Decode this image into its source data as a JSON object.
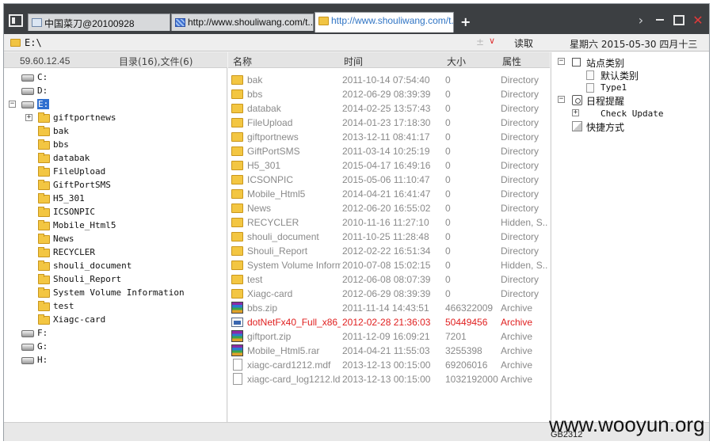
{
  "tabs": [
    {
      "label": "中国菜刀@20100928",
      "icon": "page-icon",
      "active": false
    },
    {
      "label": "http://www.shouliwang.com/t...",
      "icon": "image-icon",
      "active": false
    },
    {
      "label": "http://www.shouliwang.com/t...",
      "icon": "folder-icon",
      "active": true
    }
  ],
  "tabbar": {
    "add_label": "+",
    "menu_chevron": "›",
    "close_label": "✕"
  },
  "address": {
    "path": "E:\\",
    "plusminus": "±",
    "dropdown": "∨",
    "read_label": "读取",
    "datetime": "星期六 2015-05-30 四月十三"
  },
  "tree_header": {
    "ip": "59.60.12.45",
    "count": "目录(16),文件(6)"
  },
  "tree": {
    "drives": [
      {
        "label": "C:"
      },
      {
        "label": "D:"
      },
      {
        "label": "E:",
        "expander": "−"
      },
      {
        "label": "F:"
      },
      {
        "label": "G:"
      },
      {
        "label": "H:"
      }
    ],
    "folders": [
      {
        "label": "giftportnews",
        "expander": "+"
      },
      {
        "label": "bak"
      },
      {
        "label": "bbs"
      },
      {
        "label": "databak"
      },
      {
        "label": "FileUpload"
      },
      {
        "label": "GiftPortSMS"
      },
      {
        "label": "H5_301"
      },
      {
        "label": "ICSONPIC"
      },
      {
        "label": "Mobile_Html5"
      },
      {
        "label": "News"
      },
      {
        "label": "RECYCLER"
      },
      {
        "label": "shouli_document"
      },
      {
        "label": "Shouli_Report"
      },
      {
        "label": "System Volume Information"
      },
      {
        "label": "test"
      },
      {
        "label": "Xiagc-card"
      }
    ]
  },
  "list_header": {
    "name": "名称",
    "time": "时间",
    "size": "大小",
    "attr": "属性"
  },
  "files": [
    {
      "name": "bak",
      "time": "2011-10-14 07:54:40",
      "size": "0",
      "attr": "Directory",
      "icon": "folder"
    },
    {
      "name": "bbs",
      "time": "2012-06-29 08:39:39",
      "size": "0",
      "attr": "Directory",
      "icon": "folder"
    },
    {
      "name": "databak",
      "time": "2014-02-25 13:57:43",
      "size": "0",
      "attr": "Directory",
      "icon": "folder"
    },
    {
      "name": "FileUpload",
      "time": "2014-01-23 17:18:30",
      "size": "0",
      "attr": "Directory",
      "icon": "folder"
    },
    {
      "name": "giftportnews",
      "time": "2013-12-11 08:41:17",
      "size": "0",
      "attr": "Directory",
      "icon": "folder"
    },
    {
      "name": "GiftPortSMS",
      "time": "2011-03-14 10:25:19",
      "size": "0",
      "attr": "Directory",
      "icon": "folder"
    },
    {
      "name": "H5_301",
      "time": "2015-04-17 16:49:16",
      "size": "0",
      "attr": "Directory",
      "icon": "folder"
    },
    {
      "name": "ICSONPIC",
      "time": "2015-05-06 11:10:47",
      "size": "0",
      "attr": "Directory",
      "icon": "folder"
    },
    {
      "name": "Mobile_Html5",
      "time": "2014-04-21 16:41:47",
      "size": "0",
      "attr": "Directory",
      "icon": "folder"
    },
    {
      "name": "News",
      "time": "2012-06-20 16:55:02",
      "size": "0",
      "attr": "Directory",
      "icon": "folder"
    },
    {
      "name": "RECYCLER",
      "time": "2010-11-16 11:27:10",
      "size": "0",
      "attr": "Hidden, S...",
      "icon": "folder"
    },
    {
      "name": "shouli_document",
      "time": "2011-10-25 11:28:48",
      "size": "0",
      "attr": "Directory",
      "icon": "folder"
    },
    {
      "name": "Shouli_Report",
      "time": "2012-02-22 16:51:34",
      "size": "0",
      "attr": "Directory",
      "icon": "folder"
    },
    {
      "name": "System Volume Inform...",
      "time": "2010-07-08 15:02:15",
      "size": "0",
      "attr": "Hidden, S...",
      "icon": "folder"
    },
    {
      "name": "test",
      "time": "2012-06-08 08:07:39",
      "size": "0",
      "attr": "Directory",
      "icon": "folder"
    },
    {
      "name": "Xiagc-card",
      "time": "2012-06-29 08:39:39",
      "size": "0",
      "attr": "Directory",
      "icon": "folder"
    },
    {
      "name": "bbs.zip",
      "time": "2011-11-14 14:43:51",
      "size": "466322009",
      "attr": "Archive",
      "icon": "zip"
    },
    {
      "name": "dotNetFx40_Full_x86_...",
      "time": "2012-02-28 21:36:03",
      "size": "50449456",
      "attr": "Archive",
      "icon": "exe",
      "highlight": true
    },
    {
      "name": "giftport.zip",
      "time": "2011-12-09 16:09:21",
      "size": "7201",
      "attr": "Archive",
      "icon": "zip"
    },
    {
      "name": "Mobile_Html5.rar",
      "time": "2014-04-21 11:55:03",
      "size": "3255398",
      "attr": "Archive",
      "icon": "zip"
    },
    {
      "name": "xiagc-card1212.mdf",
      "time": "2013-12-13 00:15:00",
      "size": "69206016",
      "attr": "Archive",
      "icon": "doc"
    },
    {
      "name": "xiagc-card_log1212.ldf",
      "time": "2013-12-13 00:15:00",
      "size": "1032192000",
      "attr": "Archive",
      "icon": "doc"
    }
  ],
  "right_panel": {
    "sites_label": "站点类别",
    "sites_expander": "−",
    "site_items": [
      {
        "label": "默认类别"
      },
      {
        "label": "Type1"
      }
    ],
    "schedule_label": "日程提醒",
    "schedule_expander": "−",
    "schedule_items": [
      {
        "label": "Check Update",
        "expander": "+"
      }
    ],
    "shortcut_label": "快捷方式"
  },
  "status": {
    "encoding": "GB2312"
  },
  "watermark": "www.wooyun.org"
}
